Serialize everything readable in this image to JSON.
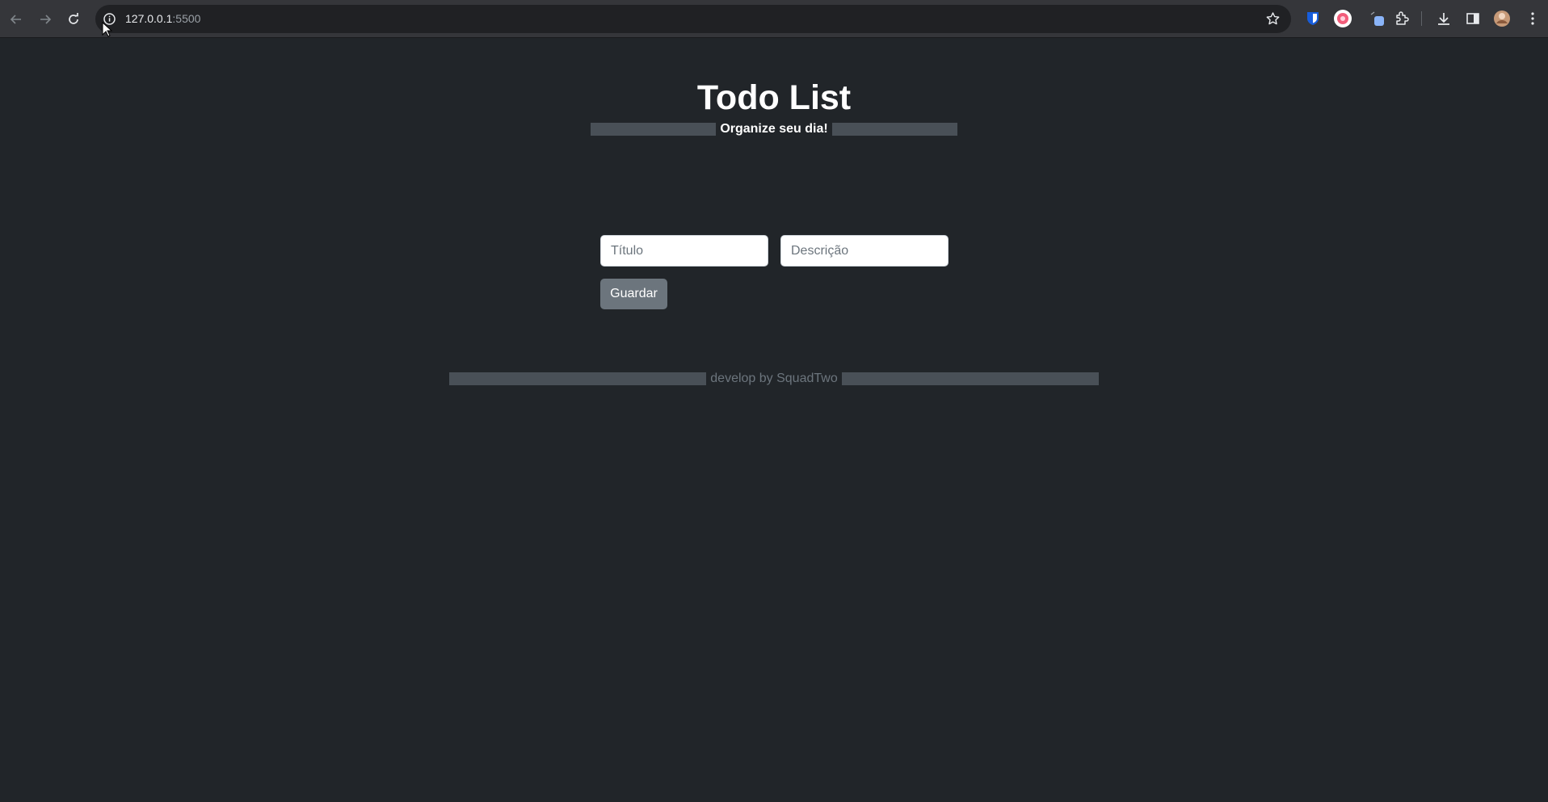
{
  "browser": {
    "url_host": "127.0.0.1",
    "url_port": ":5500",
    "nav": {
      "back_icon": "arrow-left-icon",
      "forward_icon": "arrow-right-icon",
      "reload_icon": "reload-icon"
    },
    "extensions": [
      "bitwarden-icon",
      "extension-pink-icon",
      "extension-blue-icon",
      "puzzle-icon"
    ],
    "toolbar_icons": [
      "download-icon",
      "side-panel-icon",
      "profile-avatar",
      "kebab-menu-icon"
    ]
  },
  "page": {
    "title": "Todo List",
    "subtitle": "Organize seu dia!",
    "form": {
      "title_placeholder": "Título",
      "description_placeholder": "Descrição",
      "save_label": "Guardar"
    },
    "footer": "develop by SquadTwo"
  },
  "colors": {
    "background": "#212529",
    "decor_bar": "#495057",
    "button": "#6c757d",
    "muted_text": "#6c757d"
  }
}
